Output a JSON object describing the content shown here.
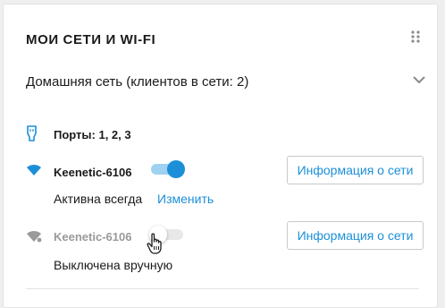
{
  "panel": {
    "title": "МОИ СЕТИ И WI-FI",
    "drag_icon": "drag-handle-icon"
  },
  "home_network": {
    "label": "Домашняя сеть (клиентов в сети: 2)",
    "expand_icon": "chevron-down-icon"
  },
  "ports": {
    "icon": "ethernet-port-icon",
    "text": "Порты: 1, 2, 3"
  },
  "networks": [
    {
      "name": "Keenetic-6106",
      "enabled": true,
      "status": "Активна всегда",
      "change_link": "Изменить",
      "info_button": "Информация о сети",
      "icon": "wifi-icon"
    },
    {
      "name": "Keenetic-6106",
      "enabled": false,
      "status": "Выключена вручную",
      "info_button": "Информация о сети",
      "icon": "wifi-icon"
    }
  ],
  "colors": {
    "accent": "#1c8fd8",
    "accent_light": "#9fd1f1",
    "disabled_text": "#9a9a9a",
    "disabled_icon": "#9a9a9a",
    "text": "#1a1a1a"
  }
}
